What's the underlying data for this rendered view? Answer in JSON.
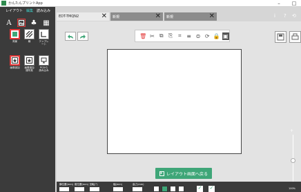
{
  "titlebar": {
    "title": "かんたんプリントApp",
    "minimize": "–",
    "close": "□"
  },
  "menu": {
    "items": [
      "レイアウト",
      "編集",
      "読み込み"
    ]
  },
  "tools": {
    "text": "A",
    "image": "▣",
    "shape": "♣",
    "grid": "▦"
  },
  "gallery": {
    "row1": [
      {
        "caption": "背景"
      },
      {
        "caption": "線"
      },
      {
        "caption": "テンプレート"
      }
    ],
    "row2": [
      {
        "caption": "画像追加"
      },
      {
        "caption": "画像追加\n顔写真"
      },
      {
        "caption": "PCから\n読み込み"
      }
    ]
  },
  "tabs": [
    {
      "label": "EDT-TMQN2",
      "close": "✕",
      "active": true
    },
    {
      "label": "新規",
      "close": "✕",
      "active": false
    },
    {
      "label": "新規",
      "close": "✕",
      "active": false
    }
  ],
  "topright": {
    "info": "i",
    "help": "?",
    "undo": "⟲"
  },
  "toolbar": {
    "icons": [
      "trash-icon",
      "cut-icon",
      "copy-icon",
      "paste-icon",
      "crop-icon",
      "layer-icon",
      "align-icon",
      "rotate-icon",
      "lock-icon",
      "group-icon"
    ]
  },
  "back_button": {
    "label": "レイアウト画面へ戻る"
  },
  "zoom": {
    "plus": "+",
    "minus": "−",
    "level": "100%"
  },
  "statusbar": {
    "labels": [
      "横位置(mm)",
      "縦位置(mm)",
      "回転(°)",
      "幅(mm)",
      "高さ(mm)",
      "縮小(%)"
    ]
  },
  "colors": {
    "accent": "#3fa678",
    "selection": "#e23636",
    "sidebar": "#3b3b3b"
  }
}
